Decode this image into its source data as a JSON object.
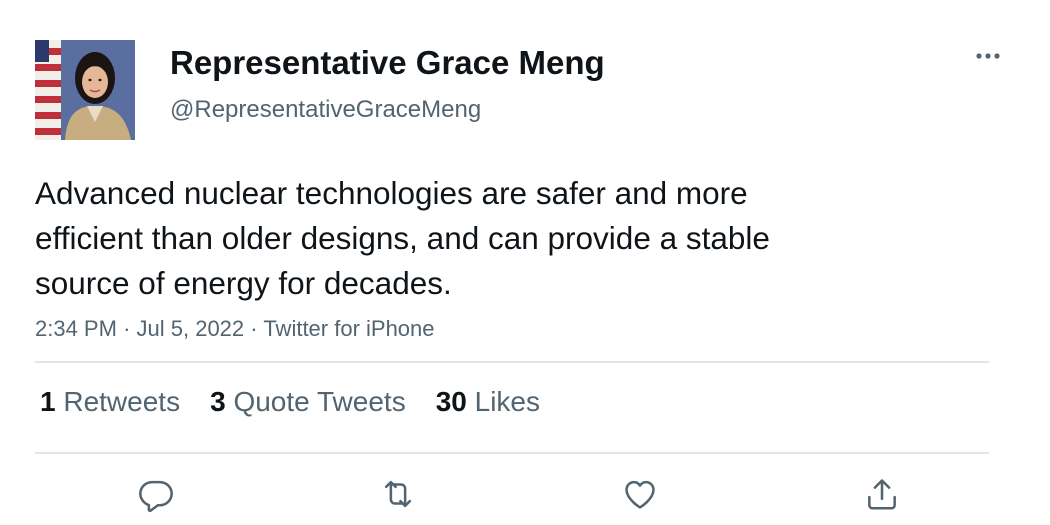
{
  "author": {
    "display_name": "Representative Grace Meng",
    "handle": "@RepresentativeGraceMeng",
    "avatar_icon": "profile-photo"
  },
  "tweet": {
    "text_lines": [
      "Advanced nuclear technologies are safer and more",
      "efficient than older designs, and can provide a stable",
      "source of energy for decades."
    ],
    "time": "2:34 PM",
    "date": "Jul 5, 2022",
    "separator": "·",
    "source": "Twitter for iPhone"
  },
  "stats": {
    "retweets": {
      "count": "1",
      "label": "Retweets"
    },
    "quotes": {
      "count": "3",
      "label": "Quote Tweets"
    },
    "likes": {
      "count": "30",
      "label": "Likes"
    }
  },
  "actions": {
    "reply_icon": "reply-icon",
    "retweet_icon": "retweet-icon",
    "like_icon": "heart-icon",
    "share_icon": "share-icon"
  },
  "colors": {
    "text_primary": "#0f1419",
    "text_secondary": "#536471",
    "divider": "#e1e5e8",
    "icon": "#536471"
  }
}
